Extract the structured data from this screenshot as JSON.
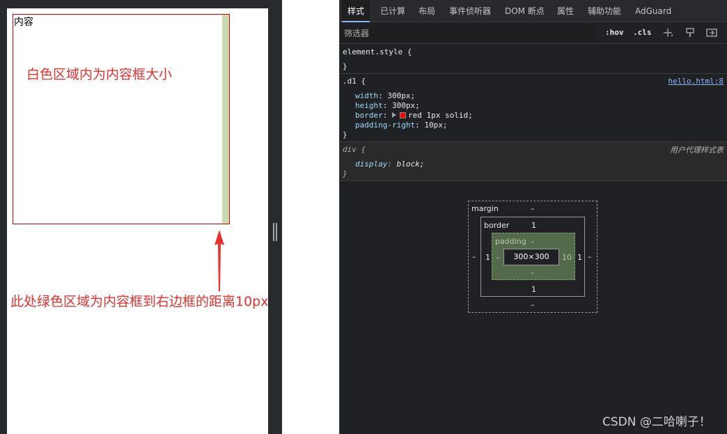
{
  "page": {
    "box_text": "内容",
    "note_white": "白色区域内为内容框大小",
    "note_green": "此处绿色区域为内容框到右边框的距离10px"
  },
  "devtools": {
    "tabs": [
      {
        "label": "样式",
        "active": true
      },
      {
        "label": "已计算"
      },
      {
        "label": "布局"
      },
      {
        "label": "事件侦听器"
      },
      {
        "label": "DOM 断点"
      },
      {
        "label": "属性"
      },
      {
        "label": "辅助功能"
      },
      {
        "label": "AdGuard"
      }
    ],
    "filter": {
      "placeholder": "筛选器",
      "hov": ":hov",
      "cls": ".cls"
    },
    "rules": {
      "element_style": {
        "open": "element.style {",
        "close": "}"
      },
      "d1": {
        "selector": ".d1 {",
        "source": "hello.html:8",
        "decls": [
          {
            "prop": "width",
            "value": "300px;"
          },
          {
            "prop": "height",
            "value": "300px;"
          },
          {
            "prop": "border",
            "value": "red 1px solid;"
          },
          {
            "prop": "padding-right",
            "value": "10px;"
          }
        ],
        "close": "}"
      },
      "ua_div": {
        "selector": "div {",
        "source": "用户代理样式表",
        "decls": [
          {
            "prop": "display",
            "value": "block;"
          }
        ],
        "close": "}"
      }
    },
    "box_model": {
      "margin_label": "margin",
      "margin": {
        "top": "–",
        "right": "–",
        "bottom": "–",
        "left": "–"
      },
      "border_label": "border",
      "border": {
        "top": "1",
        "right": "1",
        "bottom": "1",
        "left": "1"
      },
      "padding_label": "padding",
      "padding": {
        "top": "–",
        "right": "10",
        "bottom": "–",
        "left": "–"
      },
      "content": "300×300"
    }
  },
  "watermark": "CSDN @二哈喇子！",
  "colors": {
    "accent_red": "#e8302c",
    "padding_green": "#c6dcb0",
    "link_blue": "#8ab4f8"
  }
}
